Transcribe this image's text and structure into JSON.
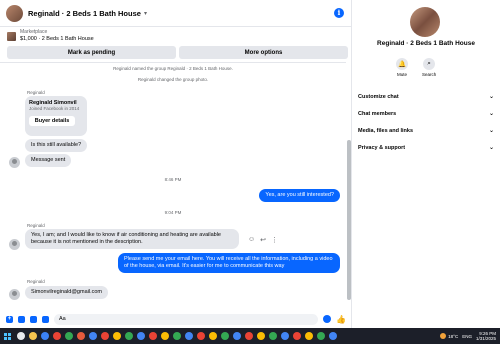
{
  "header": {
    "title": "Reginald · 2 Beds 1 Bath House"
  },
  "listing": {
    "source": "Marketplace",
    "title": "$1,000 · 2 Beds 1 Bath House"
  },
  "actions": {
    "pending": "Mark as pending",
    "more": "More options"
  },
  "system_messages": [
    "Reginald named the group Reginald · 2 Beds 1 Bath House.",
    "Reginald changed the group photo."
  ],
  "card": {
    "sender": "Reginald",
    "name": "Reginald Simonvil",
    "sub": "Joined Facebook in 2014",
    "button": "Buyer details"
  },
  "messages": {
    "available": "Is this still available?",
    "sent": "Message sent",
    "time1": "8:46 PM",
    "out1": "Yes, are you still interested?",
    "time2": "9:04 PM",
    "sender2": "Reginald",
    "in2": "Yes, I am; and I would like to know if air conditioning and heating are available because it is not mentioned in the description.",
    "out2": "Please send me your email here. You will receive all the information, including a video of the house, via email. It's easier for me to communicate this way",
    "sender3": "Reginald",
    "in3": "Simonvilreginald@gmail.com"
  },
  "composer": {
    "value": "Aa"
  },
  "info": {
    "name": "Reginald · 2 Beds 1 Bath House",
    "mute": "Mute",
    "search": "Search",
    "sections": [
      "Customize chat",
      "Chat members",
      "Media, files and links",
      "Privacy & support"
    ]
  },
  "taskbar": {
    "temp": "18°C",
    "lang": "ENG",
    "time": "9:26 PM",
    "date": "1/31/2025"
  },
  "colors": {
    "accent": "#0866ff",
    "bubble_in": "#e4e6eb"
  }
}
